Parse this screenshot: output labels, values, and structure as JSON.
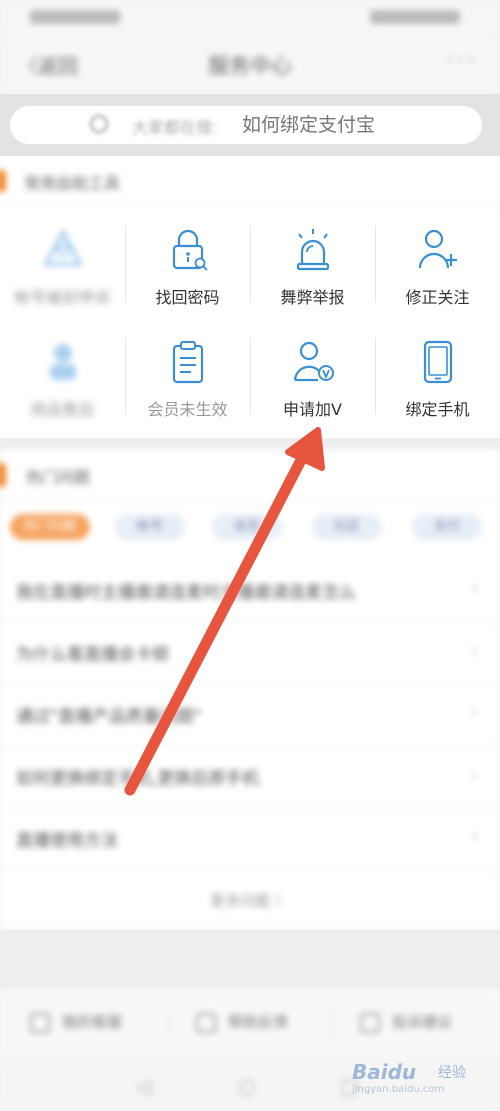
{
  "header": {
    "back_label": "〈返回",
    "title": "服务中心",
    "more_label": "···"
  },
  "search": {
    "hint": "大家都在搜:",
    "hot_query": "如何绑定支付宝"
  },
  "tools": {
    "section_title": "常用自助工具",
    "items": [
      {
        "label": "帐号被封申诉",
        "icon": "triangle-user-icon",
        "blurred": true
      },
      {
        "label": "找回密码",
        "icon": "lock-icon",
        "blurred": false
      },
      {
        "label": "舞弊举报",
        "icon": "siren-icon",
        "blurred": false
      },
      {
        "label": "修正关注",
        "icon": "add-user-icon",
        "blurred": false
      },
      {
        "label": "商品售后",
        "icon": "user-group-icon",
        "blurred": true
      },
      {
        "label": "会员未生效",
        "icon": "clipboard-icon",
        "blurred": false
      },
      {
        "label": "申请加V",
        "icon": "verified-user-icon",
        "blurred": false
      },
      {
        "label": "绑定手机",
        "icon": "phone-icon",
        "blurred": false
      }
    ]
  },
  "hot": {
    "section_title": "热门问题",
    "chips": [
      "热门问题",
      "帐号",
      "会员",
      "社区",
      "支付"
    ],
    "questions": [
      "我在直播时主播邀请连麦时主播邀请连麦怎么",
      "为什么看直播会卡顿",
      "通过\"直播产品质量问题\"",
      "如何更换绑定手机,更换后原手机",
      "直播使用方法"
    ],
    "more_label": "更多问题 〉"
  },
  "bottom_bar": {
    "items": [
      "我的客服",
      "帮助反馈",
      "投诉建议"
    ]
  },
  "watermark": {
    "brand": "Baidu",
    "sub": "经验",
    "url": "jingyan.baidu.com"
  },
  "colors": {
    "accent": "#f08a2d",
    "icon_blue": "#3a8fd4",
    "arrow_red": "#e8553e"
  }
}
